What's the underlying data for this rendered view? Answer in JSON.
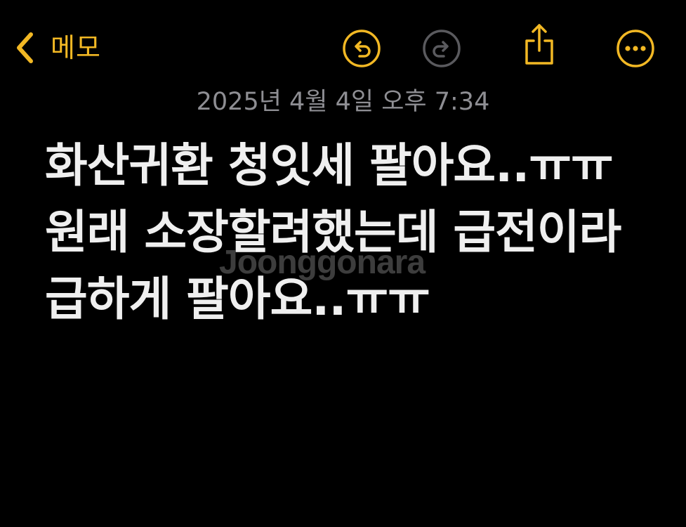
{
  "toolbar": {
    "back_label": "메모",
    "back_icon": "chevron-left-icon",
    "undo_icon": "undo-icon",
    "redo_icon": "redo-icon",
    "share_icon": "share-icon",
    "more_icon": "ellipsis-icon"
  },
  "note": {
    "date": "2025년 4월 4일 오후 7:34",
    "lines": [
      "화산귀환 청잇세 팔아요..ㅠㅠ",
      "원래 소장할려했는데 급전이라",
      "급하게 팔아요..ㅠㅠ"
    ]
  },
  "watermark": "Joonggonara",
  "colors": {
    "background": "#000000",
    "accent": "#F2B824",
    "disabled": "#5A5A5E",
    "date_text": "#8E8E93",
    "body_text": "#EFEFEF"
  }
}
